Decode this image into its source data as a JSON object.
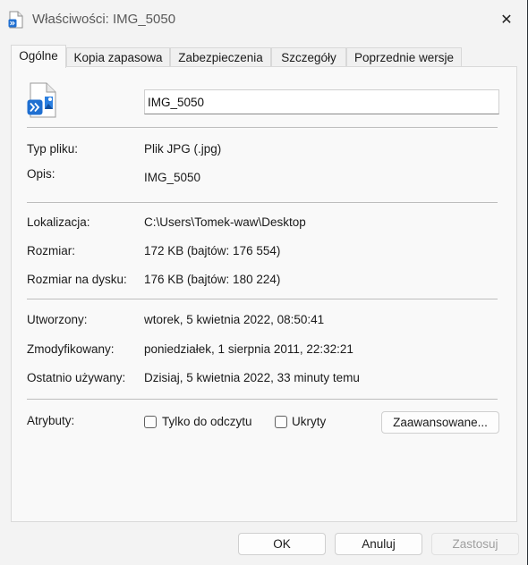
{
  "window": {
    "title": "Właściwości: IMG_5050",
    "close_glyph": "✕"
  },
  "tabs": [
    {
      "label": "Ogólne",
      "active": true
    },
    {
      "label": "Kopia zapasowa",
      "active": false
    },
    {
      "label": "Zabezpieczenia",
      "active": false
    },
    {
      "label": "Szczegóły",
      "active": false
    },
    {
      "label": "Poprzednie wersje",
      "active": false
    }
  ],
  "general": {
    "file_name": "IMG_5050",
    "file_type": {
      "label": "Typ pliku:",
      "value": "Plik JPG (.jpg)"
    },
    "description": {
      "label": "Opis:",
      "value": "IMG_5050"
    },
    "location": {
      "label": "Lokalizacja:",
      "value": "C:\\Users\\Tomek-waw\\Desktop"
    },
    "size": {
      "label": "Rozmiar:",
      "value": "172 KB (bajtów: 176 554)"
    },
    "size_on_disk": {
      "label": "Rozmiar na dysku:",
      "value": "176 KB (bajtów: 180 224)"
    },
    "created": {
      "label": "Utworzony:",
      "value": "wtorek, 5 kwietnia 2022, 08:50:41"
    },
    "modified": {
      "label": "Zmodyfikowany:",
      "value": "poniedziałek, 1 sierpnia 2011, 22:32:21"
    },
    "accessed": {
      "label": "Ostatnio używany:",
      "value": "Dzisiaj, 5 kwietnia 2022, 33 minuty temu"
    },
    "attributes": {
      "label": "Atrybuty:",
      "read_only": {
        "label": "Tylko do odczytu",
        "checked": false
      },
      "hidden": {
        "label": "Ukryty",
        "checked": false
      },
      "advanced_label": "Zaawansowane..."
    }
  },
  "buttons": {
    "ok": "OK",
    "cancel": "Anuluj",
    "apply": "Zastosuj",
    "apply_enabled": false
  },
  "colors": {
    "icon_blue": "#1f6fd1",
    "dialog_background": "#f3f3f3",
    "desktop_background": "#16202b"
  }
}
